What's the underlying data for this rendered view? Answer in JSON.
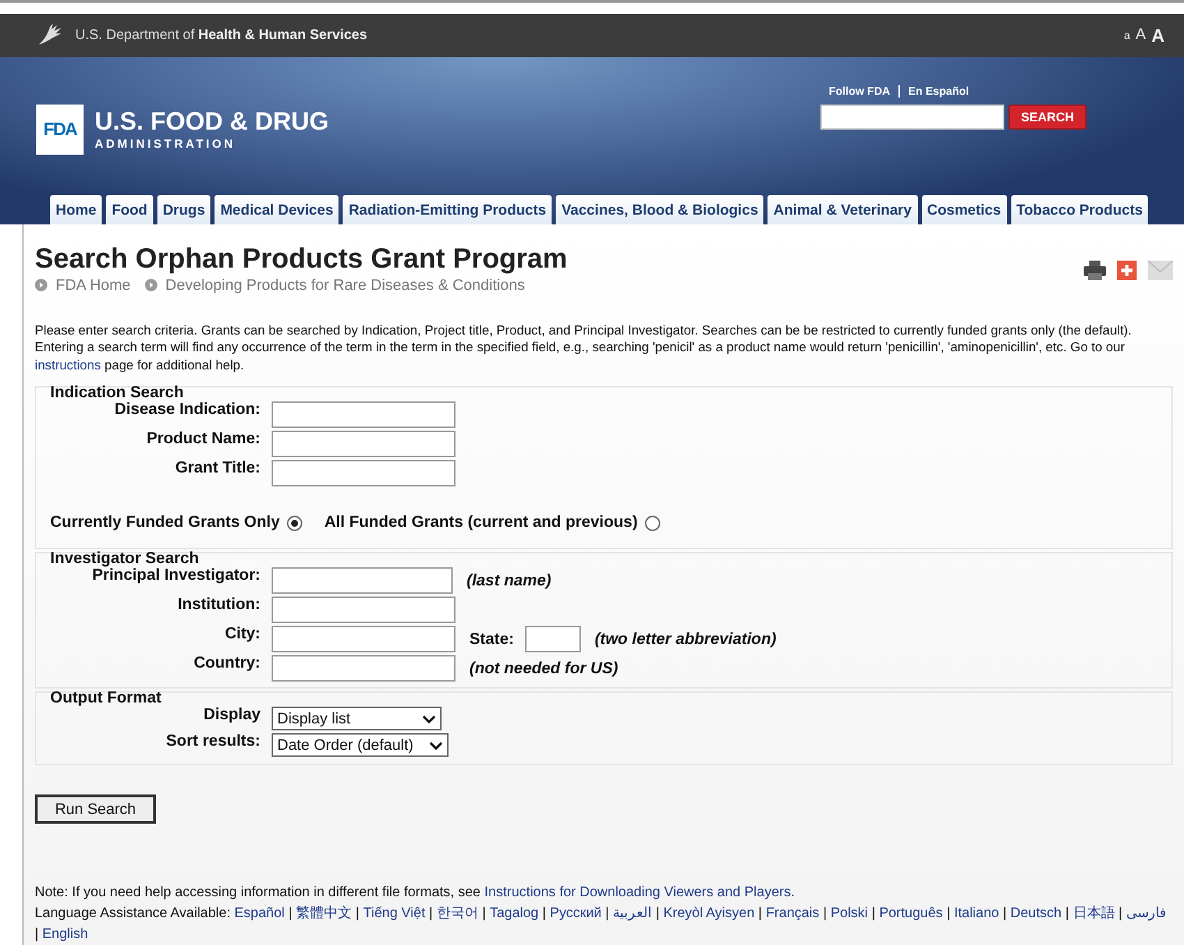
{
  "hhs_bar": {
    "text": "U.S. Department of **Health & Human Services**",
    "text_sizes": [
      "a",
      "A",
      "A"
    ]
  },
  "header": {
    "logo_mark": "FDA",
    "logo_title": "U.S. FOOD & DRUG",
    "logo_subtitle": "ADMINISTRATION",
    "links": [
      "Follow FDA",
      "En Español"
    ],
    "search_button": "SEARCH"
  },
  "nav_tabs": [
    {
      "label": "Home"
    },
    {
      "label": "Food"
    },
    {
      "label": "Drugs"
    },
    {
      "label": "Medical Devices"
    },
    {
      "label": "Radiation-Emitting Products"
    },
    {
      "label": "Vaccines, Blood & Biologics"
    },
    {
      "label": "Animal & Veterinary"
    },
    {
      "label": "Cosmetics"
    },
    {
      "label": "Tobacco Products"
    }
  ],
  "page_title": "Search Orphan Products Grant Program",
  "breadcrumbs": [
    "FDA Home",
    "Developing Products for Rare Diseases & Conditions"
  ],
  "intro": {
    "before": "Please enter search criteria. Grants can be searched by Indication, Project title, Product, and Principal Investigator. Searches can be be restricted to currently funded grants only (the default). Entering a search term will find any occurrence of the term in the term in the specified field, e.g., searching 'penicil' as a product name would return 'penicillin', 'aminopenicillin', etc. Go to our ",
    "link": "instructions",
    "after": " page for additional help."
  },
  "indication_search": {
    "legend": "Indication Search",
    "fields": [
      {
        "label": "Disease Indication:"
      },
      {
        "label": "Product Name:"
      },
      {
        "label": "Grant Title:"
      }
    ]
  },
  "funding_options": [
    {
      "label": "Currently Funded Grants Only",
      "selected": true
    },
    {
      "label": "All Funded Grants (current and previous)",
      "selected": false
    }
  ],
  "investigator_search": {
    "legend": "Investigator Search",
    "fields": [
      {
        "label": "Principal Investigator:",
        "kind": "wide",
        "note": "(last name)"
      },
      {
        "label": "Institution:",
        "kind": "plain"
      },
      {
        "label": "City:",
        "kind": "state",
        "extra_label": "State:",
        "note": "(two letter abbreviation)"
      },
      {
        "label": "Country:",
        "kind": "plain",
        "note": "(not needed for US)"
      }
    ]
  },
  "output_format": {
    "legend": "Output Format",
    "fields": [
      {
        "label": "Display",
        "value": "Display list"
      },
      {
        "label": "Sort results:",
        "value": "Date Order (default)"
      }
    ]
  },
  "run_button": "Run Search",
  "footer": {
    "note": "Note: If you need help accessing information in different file formats, see ",
    "note_link": "Instructions for Downloading Viewers and Players",
    "note_end": ".",
    "languages_label": "Language Assistance Available:",
    "separator": "|",
    "languages": [
      "Español",
      "繁體中文",
      "Tiếng Việt",
      "한국어",
      "Tagalog",
      "Русский",
      "العربية",
      "Kreyòl Ayisyen",
      "Français",
      "Polski",
      "Português",
      "Italiano",
      "Deutsch",
      "日本語",
      "فارسی",
      "English"
    ]
  }
}
